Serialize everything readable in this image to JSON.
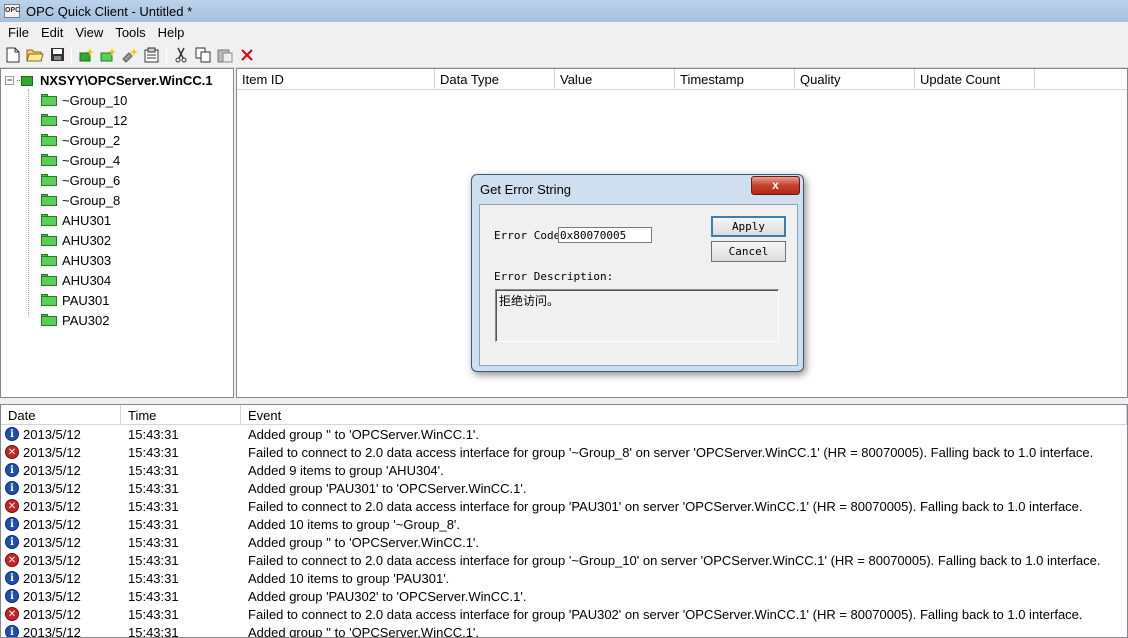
{
  "window": {
    "title": "OPC Quick Client - Untitled *",
    "app_icon_text": "OPC"
  },
  "menu": [
    "File",
    "Edit",
    "View",
    "Tools",
    "Help"
  ],
  "tree": {
    "root": "NXSYY\\OPCServer.WinCC.1",
    "root_expander": "−",
    "groups": [
      "~Group_10",
      "~Group_12",
      "~Group_2",
      "~Group_4",
      "~Group_6",
      "~Group_8",
      "AHU301",
      "AHU302",
      "AHU303",
      "AHU304",
      "PAU301",
      "PAU302"
    ]
  },
  "item_list": {
    "columns": [
      "Item ID",
      "Data Type",
      "Value",
      "Timestamp",
      "Quality",
      "Update Count"
    ]
  },
  "event_log": {
    "columns": [
      "Date",
      "Time",
      "Event"
    ],
    "rows": [
      {
        "type": "info",
        "date": "2013/5/12",
        "time": "15:43:31",
        "event": "Added group '' to 'OPCServer.WinCC.1'."
      },
      {
        "type": "error",
        "date": "2013/5/12",
        "time": "15:43:31",
        "event": "Failed to connect to 2.0 data access interface for group '~Group_8' on server 'OPCServer.WinCC.1' (HR = 80070005).  Falling back to 1.0 interface."
      },
      {
        "type": "info",
        "date": "2013/5/12",
        "time": "15:43:31",
        "event": "Added 9 items to group 'AHU304'."
      },
      {
        "type": "info",
        "date": "2013/5/12",
        "time": "15:43:31",
        "event": "Added group 'PAU301' to 'OPCServer.WinCC.1'."
      },
      {
        "type": "error",
        "date": "2013/5/12",
        "time": "15:43:31",
        "event": "Failed to connect to 2.0 data access interface for group 'PAU301' on server 'OPCServer.WinCC.1' (HR = 80070005).  Falling back to 1.0 interface."
      },
      {
        "type": "info",
        "date": "2013/5/12",
        "time": "15:43:31",
        "event": "Added 10 items to group '~Group_8'."
      },
      {
        "type": "info",
        "date": "2013/5/12",
        "time": "15:43:31",
        "event": "Added group '' to 'OPCServer.WinCC.1'."
      },
      {
        "type": "error",
        "date": "2013/5/12",
        "time": "15:43:31",
        "event": "Failed to connect to 2.0 data access interface for group '~Group_10' on server 'OPCServer.WinCC.1' (HR = 80070005).  Falling back to 1.0 interface."
      },
      {
        "type": "info",
        "date": "2013/5/12",
        "time": "15:43:31",
        "event": "Added 10 items to group 'PAU301'."
      },
      {
        "type": "info",
        "date": "2013/5/12",
        "time": "15:43:31",
        "event": "Added group 'PAU302' to 'OPCServer.WinCC.1'."
      },
      {
        "type": "error",
        "date": "2013/5/12",
        "time": "15:43:31",
        "event": "Failed to connect to 2.0 data access interface for group 'PAU302' on server 'OPCServer.WinCC.1' (HR = 80070005).  Falling back to 1.0 interface."
      },
      {
        "type": "info",
        "date": "2013/5/12",
        "time": "15:43:31",
        "event": "Added group '' to 'OPCServer.WinCC.1'."
      }
    ]
  },
  "dialog": {
    "title": "Get Error String",
    "close_glyph": "x",
    "error_code_label": "Error Code",
    "error_code_value": "0x80070005",
    "apply_label": "Apply",
    "cancel_label": "Cancel",
    "description_label": "Error Description:",
    "description_value": "拒绝访问。"
  },
  "icons": {
    "info_glyph": "i",
    "error_glyph": "✕",
    "toolbar": [
      "new-file-icon",
      "open-folder-icon",
      "save-icon",
      "new-server-icon",
      "new-group-icon",
      "new-item-icon",
      "properties-icon",
      "cut-icon",
      "copy-icon",
      "paste-icon",
      "delete-icon"
    ]
  }
}
